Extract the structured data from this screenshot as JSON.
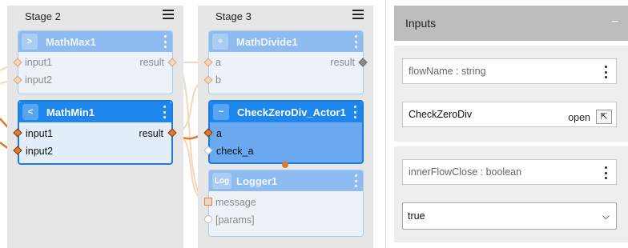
{
  "stages": [
    {
      "title": "Stage 2"
    },
    {
      "title": "Stage 3"
    }
  ],
  "nodes": {
    "math_max": {
      "badge": ">",
      "title": "MathMax1",
      "inputs": [
        "input1",
        "input2"
      ],
      "output": "result"
    },
    "math_min": {
      "badge": "<",
      "title": "MathMin1",
      "inputs": [
        "input1",
        "input2"
      ],
      "output": "result"
    },
    "math_divide": {
      "badge": "÷",
      "title": "MathDivide1",
      "inputs": [
        "a",
        "b"
      ],
      "output": "result"
    },
    "check_zero": {
      "badge": "~",
      "title": "CheckZeroDiv_Actor1",
      "inputs": [
        "a",
        "check_a"
      ]
    },
    "logger": {
      "badge": "Log",
      "title": "Logger1",
      "inputs": [
        "message",
        "[params]"
      ]
    }
  },
  "panel": {
    "title": "Inputs",
    "collapse_label": "−",
    "fields": [
      {
        "label": "flowName : string",
        "value": "CheckZeroDiv",
        "open_label": "open",
        "open_icon": "⇱"
      },
      {
        "label": "innerFlowClose : boolean",
        "selected": "true"
      }
    ]
  },
  "colors": {
    "stage_bg": "#e6e6e6",
    "node_header_active": "#1f86ee",
    "node_header_dim": "#8fbcf0",
    "wire_active": "#e07a2a",
    "wire_dim": "#f3d6bd"
  }
}
